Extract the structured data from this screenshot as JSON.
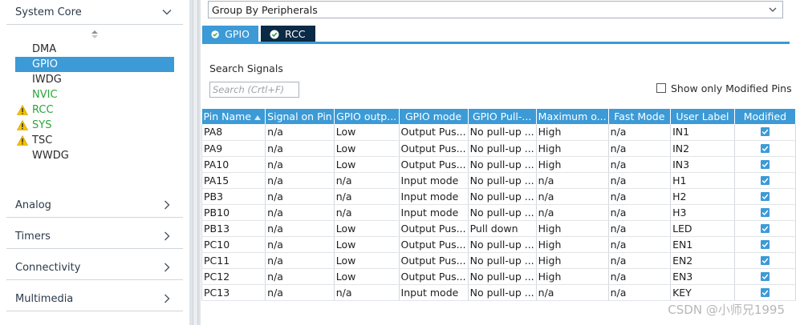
{
  "left_panel": {
    "system_core": {
      "label": "System Core",
      "items": [
        {
          "label": "DMA"
        },
        {
          "label": "GPIO"
        },
        {
          "label": "IWDG"
        },
        {
          "label": "NVIC"
        },
        {
          "label": "RCC"
        },
        {
          "label": "SYS"
        },
        {
          "label": "TSC"
        },
        {
          "label": "WWDG"
        }
      ]
    },
    "categories": [
      {
        "label": "Analog"
      },
      {
        "label": "Timers"
      },
      {
        "label": "Connectivity"
      },
      {
        "label": "Multimedia"
      }
    ]
  },
  "right_panel": {
    "group_by": {
      "value": "Group By Peripherals"
    },
    "tabs": [
      {
        "label": "GPIO"
      },
      {
        "label": "RCC"
      }
    ],
    "search": {
      "label": "Search Signals",
      "placeholder": "Search (Crtl+F)"
    },
    "show_modified": {
      "label": "Show only Modified Pins",
      "checked": false
    },
    "table": {
      "headers": [
        "Pin Name",
        "Signal on Pin",
        "GPIO outp...",
        "GPIO mode",
        "GPIO Pull-...",
        "Maximum o...",
        "Fast Mode",
        "User Label",
        "Modified"
      ],
      "rows": [
        {
          "pin": "PA8",
          "signal": "n/a",
          "output": "Low",
          "mode": "Output Pus...",
          "pull": "No pull-up ...",
          "max": "High",
          "fast": "n/a",
          "label": "IN1",
          "modified": true
        },
        {
          "pin": "PA9",
          "signal": "n/a",
          "output": "Low",
          "mode": "Output Pus...",
          "pull": "No pull-up ...",
          "max": "High",
          "fast": "n/a",
          "label": "IN2",
          "modified": true
        },
        {
          "pin": "PA10",
          "signal": "n/a",
          "output": "Low",
          "mode": "Output Pus...",
          "pull": "No pull-up ...",
          "max": "High",
          "fast": "n/a",
          "label": "IN3",
          "modified": true
        },
        {
          "pin": "PA15",
          "signal": "n/a",
          "output": "n/a",
          "mode": "Input mode",
          "pull": "No pull-up ...",
          "max": "n/a",
          "fast": "n/a",
          "label": "H1",
          "modified": true
        },
        {
          "pin": "PB3",
          "signal": "n/a",
          "output": "n/a",
          "mode": "Input mode",
          "pull": "No pull-up ...",
          "max": "n/a",
          "fast": "n/a",
          "label": "H2",
          "modified": true
        },
        {
          "pin": "PB10",
          "signal": "n/a",
          "output": "n/a",
          "mode": "Input mode",
          "pull": "No pull-up ...",
          "max": "n/a",
          "fast": "n/a",
          "label": "H3",
          "modified": true
        },
        {
          "pin": "PB13",
          "signal": "n/a",
          "output": "Low",
          "mode": "Output Pus...",
          "pull": "Pull down",
          "max": "High",
          "fast": "n/a",
          "label": "LED",
          "modified": true
        },
        {
          "pin": "PC10",
          "signal": "n/a",
          "output": "Low",
          "mode": "Output Pus...",
          "pull": "No pull-up ...",
          "max": "High",
          "fast": "n/a",
          "label": "EN1",
          "modified": true
        },
        {
          "pin": "PC11",
          "signal": "n/a",
          "output": "Low",
          "mode": "Output Pus...",
          "pull": "No pull-up ...",
          "max": "High",
          "fast": "n/a",
          "label": "EN2",
          "modified": true
        },
        {
          "pin": "PC12",
          "signal": "n/a",
          "output": "Low",
          "mode": "Output Pus...",
          "pull": "No pull-up ...",
          "max": "High",
          "fast": "n/a",
          "label": "EN3",
          "modified": true
        },
        {
          "pin": "PC13",
          "signal": "n/a",
          "output": "n/a",
          "mode": "Input mode",
          "pull": "No pull-up ...",
          "max": "n/a",
          "fast": "n/a",
          "label": "KEY",
          "modified": true
        }
      ]
    }
  },
  "watermark": "CSDN @小师兄1995",
  "colors": {
    "accent": "#3c9ad6",
    "tab_dark": "#0b2a45",
    "ok_green": "#2da33a",
    "warning": "#f2c200"
  }
}
